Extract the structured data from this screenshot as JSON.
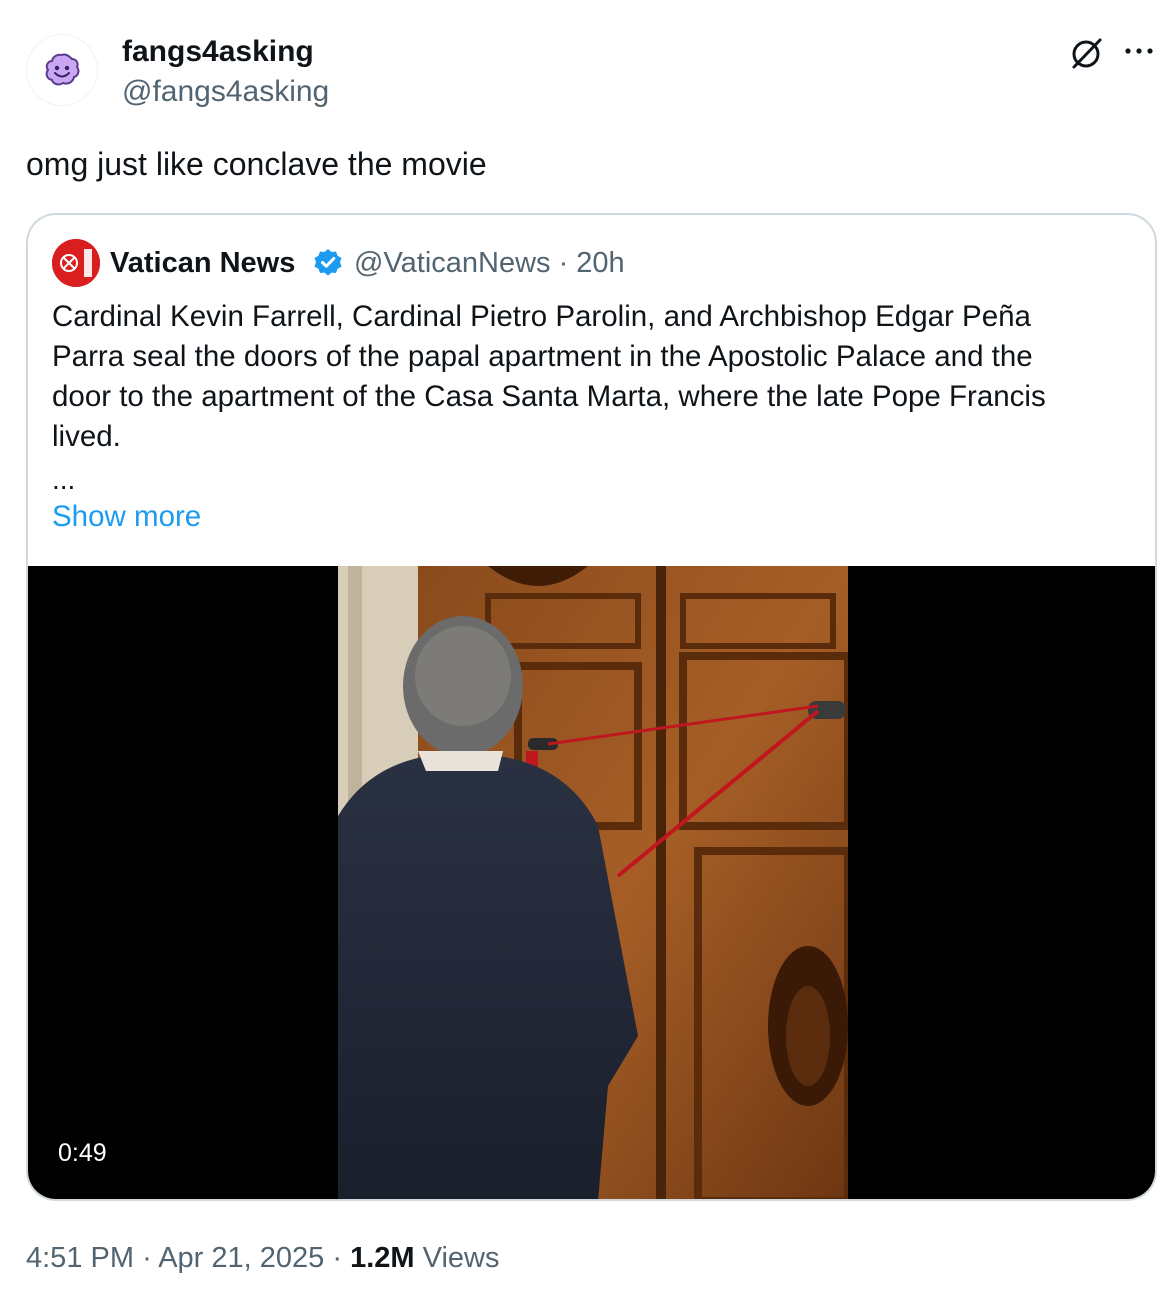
{
  "author": {
    "display_name": "fangs4asking",
    "handle": "@fangs4asking",
    "avatar_icon": "purple-smiley-blob"
  },
  "tweet": {
    "text": "omg just like conclave the movie"
  },
  "actions": {
    "grok_icon": "grok-icon",
    "more_icon": "more-horizontal-icon"
  },
  "quote": {
    "author_name": "Vatican News",
    "verified": true,
    "handle_and_time": "@VaticanNews · 20h",
    "lines": [
      "Cardinal Kevin Farrell, Cardinal Pietro Parolin, and Archbishop Edgar Peña",
      "Parra seal the doors of the papal apartment in the Apostolic Palace and the",
      "door to the apartment of the Casa Santa Marta, where the late Pope Francis",
      "lived."
    ],
    "ellipsis": "...",
    "show_more": "Show more",
    "video": {
      "duration": "0:49"
    }
  },
  "meta": {
    "time": "4:51 PM",
    "separator": "·",
    "date": "Apr 21, 2025",
    "views_count": "1.2M",
    "views_label": "Views"
  },
  "colors": {
    "text": "#0f1419",
    "secondary": "#536471",
    "link": "#1d9bf0",
    "border": "#cfd9de",
    "verified": "#1d9bf0",
    "vatican_red": "#d81e1e"
  }
}
